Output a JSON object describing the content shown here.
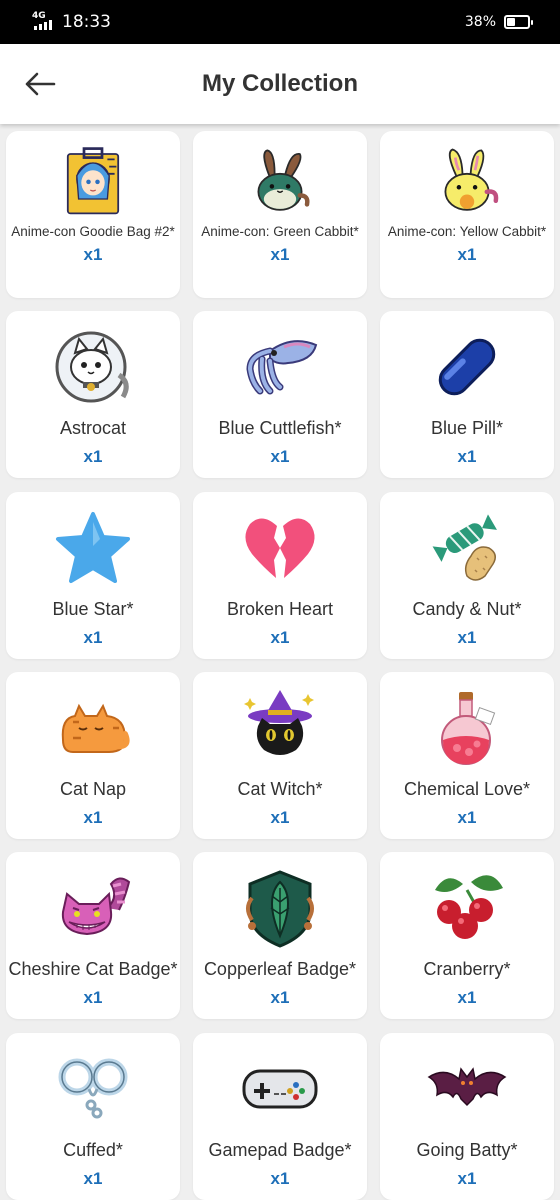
{
  "status": {
    "network": "4G",
    "time": "18:33",
    "battery": "38%",
    "battery_level": 0.38
  },
  "header": {
    "title": "My Collection",
    "back_icon": "arrow-left-icon"
  },
  "colors": {
    "accent": "#1e6fb8",
    "title": "#333333",
    "background": "#efefef"
  },
  "items": [
    {
      "name": "Anime-con Goodie Bag #2*",
      "qty": "x1",
      "icon": "goodie-bag-icon"
    },
    {
      "name": "Anime-con: Green Cabbit*",
      "qty": "x1",
      "icon": "green-cabbit-icon"
    },
    {
      "name": "Anime-con: Yellow Cabbit*",
      "qty": "x1",
      "icon": "yellow-cabbit-icon"
    },
    {
      "name": "Astrocat",
      "qty": "x1",
      "icon": "astrocat-icon"
    },
    {
      "name": "Blue Cuttlefish*",
      "qty": "x1",
      "icon": "cuttlefish-icon"
    },
    {
      "name": "Blue Pill*",
      "qty": "x1",
      "icon": "blue-pill-icon"
    },
    {
      "name": "Blue Star*",
      "qty": "x1",
      "icon": "blue-star-icon"
    },
    {
      "name": "Broken Heart",
      "qty": "x1",
      "icon": "broken-heart-icon"
    },
    {
      "name": "Candy & Nut*",
      "qty": "x1",
      "icon": "candy-nut-icon"
    },
    {
      "name": "Cat Nap",
      "qty": "x1",
      "icon": "cat-nap-icon"
    },
    {
      "name": "Cat Witch*",
      "qty": "x1",
      "icon": "cat-witch-icon"
    },
    {
      "name": "Chemical Love*",
      "qty": "x1",
      "icon": "potion-icon"
    },
    {
      "name": "Cheshire Cat Badge*",
      "qty": "x1",
      "icon": "cheshire-cat-icon"
    },
    {
      "name": "Copperleaf Badge*",
      "qty": "x1",
      "icon": "copperleaf-badge-icon"
    },
    {
      "name": "Cranberry*",
      "qty": "x1",
      "icon": "cranberry-icon"
    },
    {
      "name": "Cuffed*",
      "qty": "x1",
      "icon": "handcuffs-icon"
    },
    {
      "name": "Gamepad Badge*",
      "qty": "x1",
      "icon": "gamepad-icon"
    },
    {
      "name": "Going Batty*",
      "qty": "x1",
      "icon": "bat-icon"
    }
  ]
}
